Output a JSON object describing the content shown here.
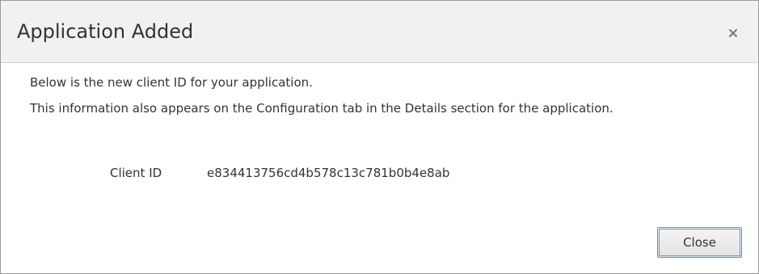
{
  "dialog": {
    "title": "Application Added",
    "close_icon": "close-icon",
    "description_line1": "Below is the new client ID for your application.",
    "description_line2": "This information also appears on the Configuration tab in the Details section for the application.",
    "client_id_label": "Client ID",
    "client_id_value": "e834413756cd4b578c13c781b0b4e8ab",
    "close_button_label": "Close"
  },
  "colors": {
    "header_background": "#f1f1f1",
    "text": "#333333",
    "button_focus_outline": "#5b9bd5"
  }
}
